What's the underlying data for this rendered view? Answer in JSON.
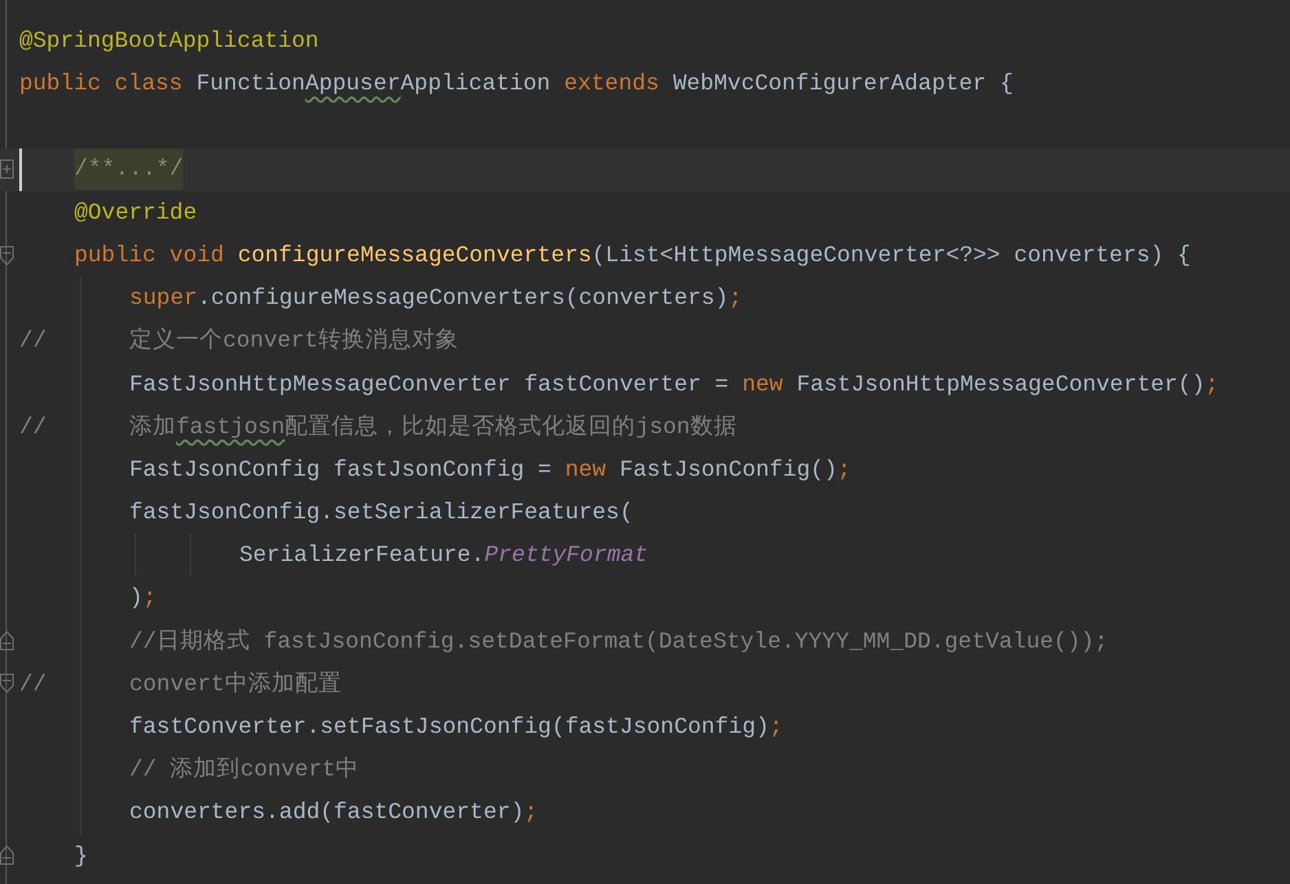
{
  "lines": [
    {
      "kind": "code",
      "tokens": [
        {
          "kind": "annotation",
          "text": "@SpringBootApplication"
        }
      ]
    },
    {
      "kind": "code",
      "tokens": [
        {
          "kind": "keyword",
          "text": "public class "
        },
        {
          "kind": "plain",
          "text": "Function"
        },
        {
          "kind": "plain",
          "text": "Appuser",
          "typo": true
        },
        {
          "kind": "plain",
          "text": "Application "
        },
        {
          "kind": "keyword",
          "text": "extends "
        },
        {
          "kind": "plain",
          "text": "WebMvcConfigurerAdapter {"
        }
      ],
      "children": [
        {
          "kind": "blank"
        },
        {
          "kind": "code",
          "current": true,
          "fold": {
            "kind": "expand"
          },
          "tokens": [
            {
              "kind": "folded",
              "text": "/**...*/"
            }
          ]
        },
        {
          "kind": "code",
          "tokens": [
            {
              "kind": "annotation",
              "text": "@Override"
            }
          ]
        },
        {
          "kind": "code",
          "fold": {
            "kind": "start"
          },
          "tokens": [
            {
              "kind": "keyword",
              "text": "public void "
            },
            {
              "kind": "method",
              "text": "configureMessageConverters"
            },
            {
              "kind": "plain",
              "text": "(List<HttpMessageConverter<?>> converters) {"
            }
          ],
          "children": [
            {
              "kind": "code",
              "tokens": [
                {
                  "kind": "keyword",
                  "text": "super"
                },
                {
                  "kind": "plain",
                  "text": ".configureMessageConverters(converters)"
                },
                {
                  "kind": "keyword",
                  "text": ";"
                }
              ]
            },
            {
              "kind": "code",
              "prefix": "//",
              "tokens": [
                {
                  "kind": "comment",
                  "text": "定义一个convert转换消息对象"
                }
              ]
            },
            {
              "kind": "code",
              "tokens": [
                {
                  "kind": "plain",
                  "text": "FastJsonHttpMessageConverter fastConverter = "
                },
                {
                  "kind": "keyword",
                  "text": "new "
                },
                {
                  "kind": "plain",
                  "text": "FastJsonHttpMessageConverter()"
                },
                {
                  "kind": "keyword",
                  "text": ";"
                }
              ]
            },
            {
              "kind": "code",
              "prefix": "//",
              "tokens": [
                {
                  "kind": "comment",
                  "text": "添加"
                },
                {
                  "kind": "comment",
                  "text": "fastjosn",
                  "typo": true
                },
                {
                  "kind": "comment",
                  "text": "配置信息，比如是否格式化返回的json数据"
                }
              ]
            },
            {
              "kind": "code",
              "tokens": [
                {
                  "kind": "plain",
                  "text": "FastJsonConfig fastJsonConfig = "
                },
                {
                  "kind": "keyword",
                  "text": "new "
                },
                {
                  "kind": "plain",
                  "text": "FastJsonConfig()"
                },
                {
                  "kind": "keyword",
                  "text": ";"
                }
              ]
            },
            {
              "kind": "code",
              "tokens": [
                {
                  "kind": "plain",
                  "text": "fastJsonConfig.setSerializerFeatures("
                }
              ],
              "children": [
                {
                  "kind": "wrapped",
                  "tokens": [
                    {
                      "kind": "plain",
                      "text": "SerializerFeature."
                    },
                    {
                      "kind": "constant",
                      "text": "PrettyFormat"
                    }
                  ]
                }
              ]
            },
            {
              "kind": "code",
              "tokens": [
                {
                  "kind": "plain",
                  "text": ")"
                },
                {
                  "kind": "keyword",
                  "text": ";"
                }
              ]
            },
            {
              "kind": "code",
              "fold": {
                "kind": "end"
              },
              "tokens": [
                {
                  "kind": "comment",
                  "text": "//日期格式 fastJsonConfig.setDateFormat(DateStyle.YYYY_MM_DD.getValue());"
                }
              ]
            },
            {
              "kind": "code",
              "fold": {
                "kind": "start"
              },
              "prefix": "//",
              "tokens": [
                {
                  "kind": "comment",
                  "text": "convert中添加配置"
                }
              ]
            },
            {
              "kind": "code",
              "tokens": [
                {
                  "kind": "plain",
                  "text": "fastConverter.setFastJsonConfig(fastJsonConfig)"
                },
                {
                  "kind": "keyword",
                  "text": ";"
                }
              ]
            },
            {
              "kind": "code",
              "tokens": [
                {
                  "kind": "comment",
                  "text": "// 添加到convert中"
                }
              ]
            },
            {
              "kind": "code",
              "tokens": [
                {
                  "kind": "plain",
                  "text": "converters.add(fastConverter)"
                },
                {
                  "kind": "keyword",
                  "text": ";"
                }
              ]
            }
          ]
        },
        {
          "kind": "code",
          "fold": {
            "kind": "end"
          },
          "tokens": [
            {
              "kind": "plain",
              "text": "}"
            }
          ]
        }
      ]
    }
  ]
}
